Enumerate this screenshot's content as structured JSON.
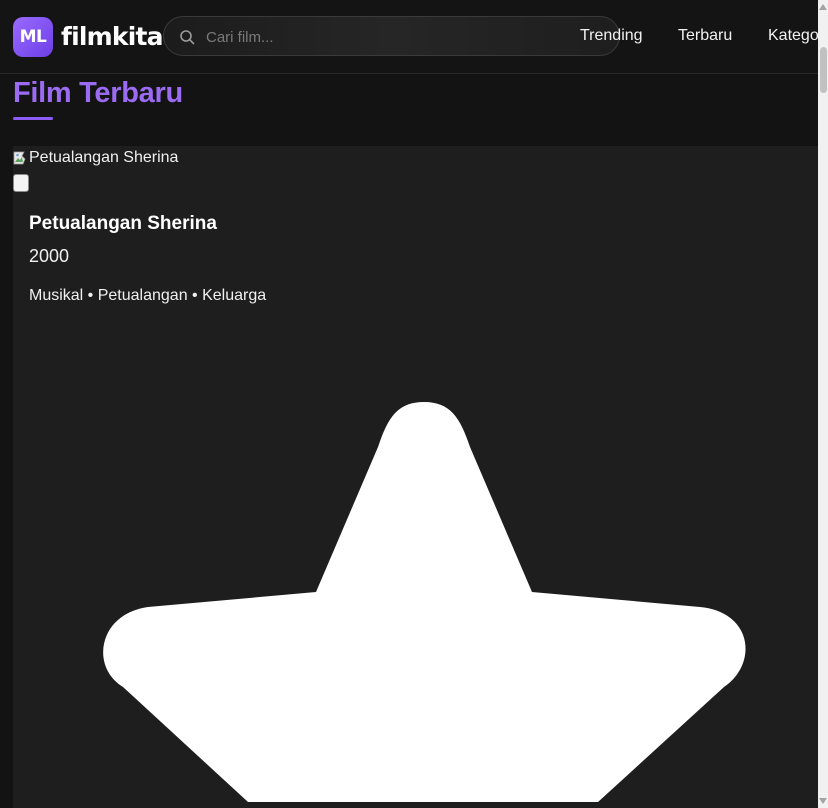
{
  "header": {
    "logo_badge": "ML",
    "logo_text": "filmkita",
    "search_placeholder": "Cari film...",
    "nav": [
      "Trending",
      "Terbaru",
      "Kategori"
    ]
  },
  "page": {
    "title": "Film Terbaru"
  },
  "movie": {
    "image_alt": "Petualangan Sherina",
    "title": "Petualangan Sherina",
    "year": "2000",
    "genres": "Musikal • Petualangan • Keluarga"
  },
  "colors": {
    "accent": "#8b5cf6",
    "title": "#9b6cf2",
    "background": "#131313",
    "card": "#1e1e1e"
  },
  "icons": {
    "search": "search-icon",
    "favorite": "star-icon"
  }
}
